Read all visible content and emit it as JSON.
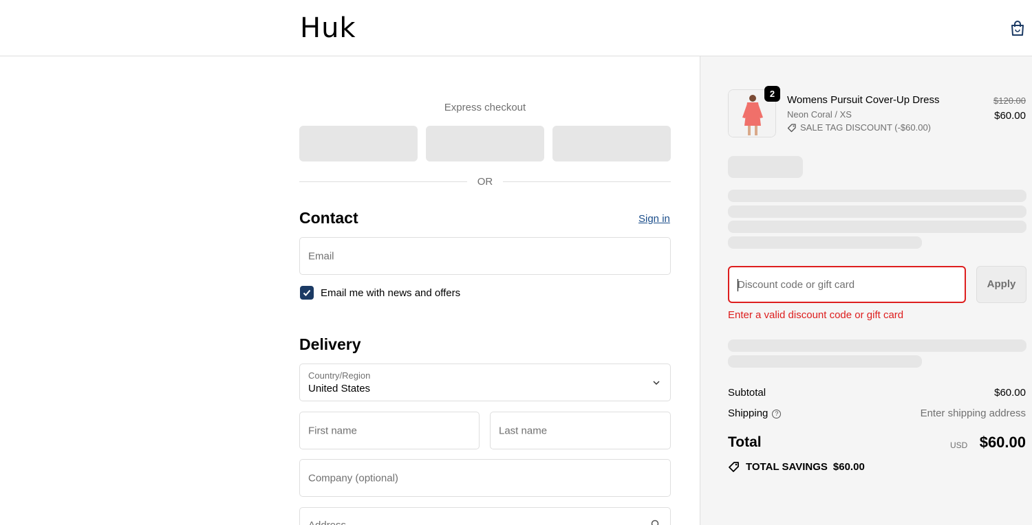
{
  "header": {
    "logo_text": "Huk",
    "cart_icon": "shopping-bag-icon"
  },
  "express": {
    "title": "Express checkout",
    "or_text": "OR"
  },
  "contact": {
    "title": "Contact",
    "sign_in": "Sign in",
    "email_placeholder": "Email",
    "newsletter_label": "Email me with news and offers",
    "newsletter_checked": true
  },
  "delivery": {
    "title": "Delivery",
    "country_label": "Country/Region",
    "country_value": "United States",
    "first_name_placeholder": "First name",
    "last_name_placeholder": "Last name",
    "company_placeholder": "Company (optional)",
    "address_placeholder": "Address"
  },
  "order": {
    "item": {
      "quantity": "2",
      "name": "Womens Pursuit Cover-Up Dress",
      "variant": "Neon Coral / XS",
      "discount": "SALE TAG DISCOUNT (-$60.00)",
      "original_price": "$120.00",
      "price": "$60.00"
    },
    "discount_placeholder": "Discount code or gift card",
    "apply_label": "Apply",
    "discount_error": "Enter a valid discount code or gift card",
    "subtotal_label": "Subtotal",
    "subtotal_value": "$60.00",
    "shipping_label": "Shipping",
    "shipping_value": "Enter shipping address",
    "total_label": "Total",
    "total_currency": "USD",
    "total_value": "$60.00",
    "savings_label": "TOTAL SAVINGS",
    "savings_value": "$60.00"
  },
  "colors": {
    "error": "#dd1d1d",
    "checkbox": "#1b3a64",
    "link": "#1a4d8a",
    "sidebar_bg": "#f5f5f5"
  }
}
